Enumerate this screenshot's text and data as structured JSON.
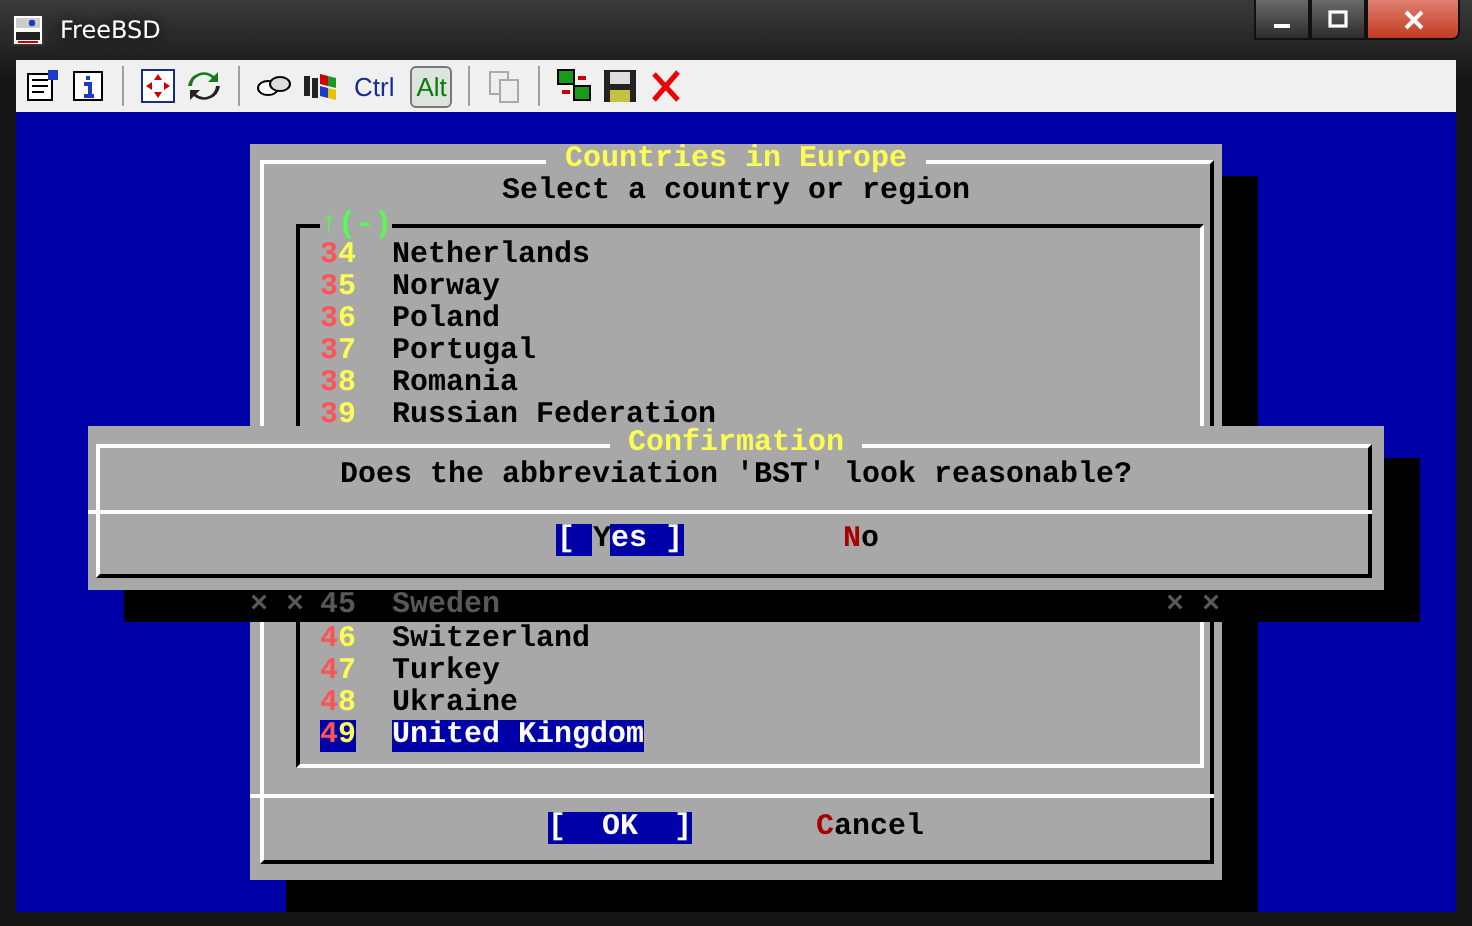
{
  "window": {
    "title": "FreeBSD"
  },
  "toolbar": {
    "ctrl": {
      "label": "Ctrl",
      "pressed": false
    },
    "alt": {
      "label": "Alt",
      "pressed": true
    }
  },
  "menu_dialog": {
    "title": "Countries in Europe",
    "prompt": "Select a country or region",
    "scroll_indicator": "↑(-)",
    "items_above": [
      {
        "number": "34",
        "name": "Netherlands",
        "selected": false
      },
      {
        "number": "35",
        "name": "Norway",
        "selected": false
      },
      {
        "number": "36",
        "name": "Poland",
        "selected": false
      },
      {
        "number": "37",
        "name": "Portugal",
        "selected": false
      },
      {
        "number": "38",
        "name": "Romania",
        "selected": false
      },
      {
        "number": "39",
        "name": "Russian Federation",
        "selected": false
      }
    ],
    "items_below": [
      {
        "number": "46",
        "name": "Switzerland",
        "selected": false
      },
      {
        "number": "47",
        "name": "Turkey",
        "selected": false
      },
      {
        "number": "48",
        "name": "Ukraine",
        "selected": false
      },
      {
        "number": "49",
        "name": "United Kingdom",
        "selected": true
      }
    ],
    "buttons": [
      {
        "before": "[  OK  ]",
        "selected": true
      },
      {
        "hotkey": "C",
        "after": "ancel",
        "selected": false
      }
    ]
  },
  "shadowed_row": {
    "left": "× ×",
    "number": "45",
    "name": "Sweden",
    "right": "× ×"
  },
  "confirmation": {
    "title": "Confirmation",
    "question": "Does the abbreviation 'BST' look reasonable?",
    "buttons": [
      {
        "before": "[ ",
        "hotkey": "Y",
        "after": "es ]",
        "selected": true
      },
      {
        "hotkey": "N",
        "after": "o",
        "selected": false
      }
    ]
  }
}
